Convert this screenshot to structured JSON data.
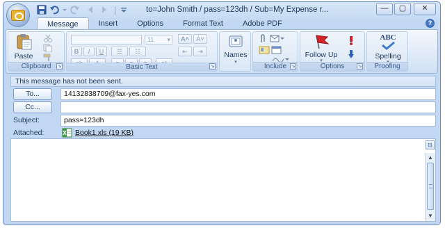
{
  "window": {
    "title": "to=John Smith / pass=123dh / Sub=My Expense r...",
    "minimize_glyph": "—",
    "maximize_glyph": "▢",
    "close_glyph": "✕"
  },
  "quick_access": {
    "save_icon": "save-icon",
    "undo_icon": "undo-icon",
    "redo_icon": "redo-icon"
  },
  "tabs": [
    {
      "label": "Message",
      "active": true
    },
    {
      "label": "Insert",
      "active": false
    },
    {
      "label": "Options",
      "active": false
    },
    {
      "label": "Format Text",
      "active": false
    },
    {
      "label": "Adobe PDF",
      "active": false
    }
  ],
  "ribbon": {
    "clipboard": {
      "label": "Clipboard",
      "paste_label": "Paste"
    },
    "basic_text": {
      "label": "Basic Text",
      "font_size": "11"
    },
    "names": {
      "label": "Names"
    },
    "include": {
      "label": "Include"
    },
    "options": {
      "label": "Options",
      "follow_up_label": "Follow Up"
    },
    "proofing": {
      "label": "Proofing",
      "spelling_label": "Spelling",
      "abc": "ABC"
    }
  },
  "message": {
    "info_text": "This message has not been sent.",
    "to_button": "To...",
    "cc_button": "Cc...",
    "to_value": "14132838709@fax-yes.com",
    "cc_value": "",
    "subject_label": "Subject:",
    "subject_value": "pass=123dh",
    "attached_label": "Attached:",
    "attachment_name": "Book1.xls (19 KB)"
  },
  "colors": {
    "accent": "#1e395b",
    "ribbon_bg": "#dce8f7",
    "window_border": "#6b8cbb"
  }
}
